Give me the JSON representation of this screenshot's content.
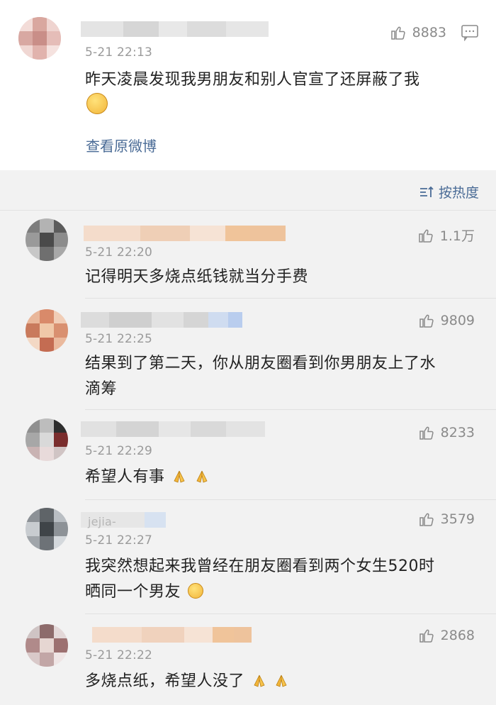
{
  "top_comment": {
    "time": "5-21 22:13",
    "likes": "8883",
    "text": "昨天凌晨发现我男朋友和别人官宣了还屏蔽了我",
    "emoji_icon": "thinking-face-icon",
    "view_original": "查看原微博"
  },
  "sort": {
    "label": "按热度",
    "icon": "sort-icon"
  },
  "replies": [
    {
      "time": "5-21 22:20",
      "likes": "1.1万",
      "lines": [
        "记得明天多烧点纸钱就当分手费"
      ]
    },
    {
      "time": "5-21 22:25",
      "likes": "9809",
      "lines": [
        "结果到了第二天，你从朋友圈看到你男朋友上了水",
        "滴筹"
      ]
    },
    {
      "time": "5-21 22:29",
      "likes": "8233",
      "lines": [
        "希望人有事"
      ],
      "emoji": "folded-hands-icon"
    },
    {
      "time": "5-21 22:27",
      "likes": "3579",
      "lines": [
        "我突然想起来我曾经在朋友圈看到两个女生520时",
        "晒同一个男友"
      ],
      "emoji": "laughing-face-icon",
      "name_fragment": "jejia-"
    },
    {
      "time": "5-21 22:22",
      "likes": "2868",
      "lines": [
        "多烧点纸，希望人没了"
      ],
      "emoji": "folded-hands-icon"
    }
  ],
  "colors": {
    "link": "#4a6b96",
    "text": "#222222",
    "meta": "#9a9a9a",
    "bg": "#f2f2f2"
  }
}
